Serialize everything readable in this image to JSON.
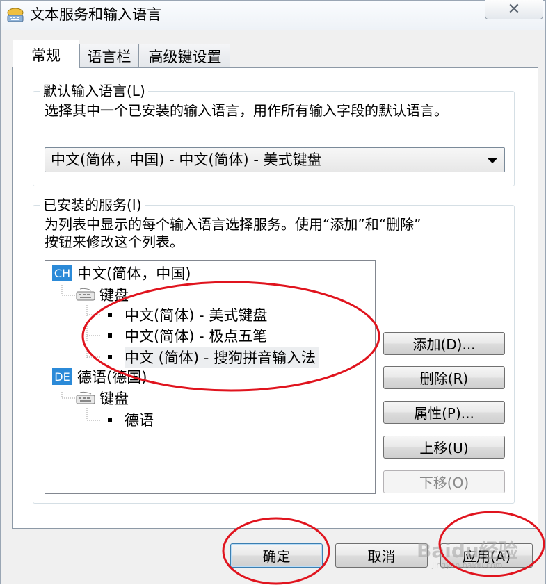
{
  "window": {
    "title": "文本服务和输入语言",
    "close_symbol": "✕",
    "app_icon": "keyboard-language-icon"
  },
  "tabs": [
    {
      "label": "常规",
      "active": true
    },
    {
      "label": "语言栏",
      "active": false
    },
    {
      "label": "高级键设置",
      "active": false
    }
  ],
  "default_language": {
    "group_title": "默认输入语言(L)",
    "description": "选择其中一个已安装的输入语言，用作所有输入字段的默认语言。",
    "selected": "中文(简体，中国) - 中文(简体) - 美式键盘"
  },
  "installed_services": {
    "group_title": "已安装的服务(I)",
    "description_line1": "为列表中显示的每个输入语言选择服务。使用“添加”和“删除”",
    "description_line2": "按钮来修改这个列表。",
    "tree": {
      "lang1": {
        "badge": "CH",
        "label": "中文(简体，中国)"
      },
      "lang1_category": "键盘",
      "lang1_items": [
        "中文(简体) - 美式键盘",
        "中文(简体) - 极点五笔",
        "中文 (简体) - 搜狗拼音输入法"
      ],
      "lang2": {
        "badge": "DE",
        "label": "德语(德国)"
      },
      "lang2_category": "键盘",
      "lang2_items": [
        "德语"
      ]
    },
    "buttons": {
      "add": "添加(D)...",
      "remove": "删除(R)",
      "properties": "属性(P)...",
      "move_up": "上移(U)",
      "move_down": "下移(O)"
    }
  },
  "footer": {
    "ok": "确定",
    "cancel": "取消",
    "apply": "应用(A)"
  },
  "watermark": {
    "brand": "Baidu经验",
    "url": "jingyan.baidu.com"
  },
  "colors": {
    "annotation": "#e0141e",
    "lang_badge": "#2b8ad8"
  }
}
